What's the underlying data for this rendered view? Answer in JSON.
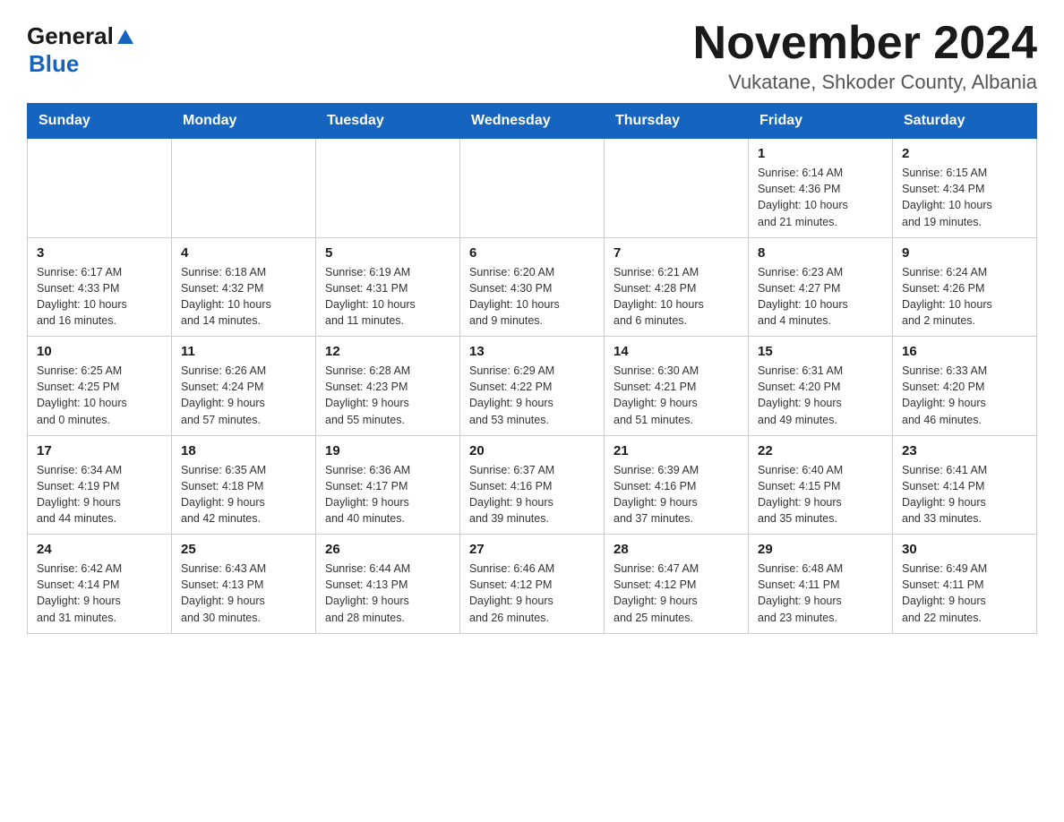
{
  "header": {
    "logo": {
      "general": "General",
      "blue": "Blue"
    },
    "title": "November 2024",
    "location": "Vukatane, Shkoder County, Albania"
  },
  "calendar": {
    "days": [
      "Sunday",
      "Monday",
      "Tuesday",
      "Wednesday",
      "Thursday",
      "Friday",
      "Saturday"
    ],
    "weeks": [
      [
        {
          "day": "",
          "info": ""
        },
        {
          "day": "",
          "info": ""
        },
        {
          "day": "",
          "info": ""
        },
        {
          "day": "",
          "info": ""
        },
        {
          "day": "",
          "info": ""
        },
        {
          "day": "1",
          "info": "Sunrise: 6:14 AM\nSunset: 4:36 PM\nDaylight: 10 hours\nand 21 minutes."
        },
        {
          "day": "2",
          "info": "Sunrise: 6:15 AM\nSunset: 4:34 PM\nDaylight: 10 hours\nand 19 minutes."
        }
      ],
      [
        {
          "day": "3",
          "info": "Sunrise: 6:17 AM\nSunset: 4:33 PM\nDaylight: 10 hours\nand 16 minutes."
        },
        {
          "day": "4",
          "info": "Sunrise: 6:18 AM\nSunset: 4:32 PM\nDaylight: 10 hours\nand 14 minutes."
        },
        {
          "day": "5",
          "info": "Sunrise: 6:19 AM\nSunset: 4:31 PM\nDaylight: 10 hours\nand 11 minutes."
        },
        {
          "day": "6",
          "info": "Sunrise: 6:20 AM\nSunset: 4:30 PM\nDaylight: 10 hours\nand 9 minutes."
        },
        {
          "day": "7",
          "info": "Sunrise: 6:21 AM\nSunset: 4:28 PM\nDaylight: 10 hours\nand 6 minutes."
        },
        {
          "day": "8",
          "info": "Sunrise: 6:23 AM\nSunset: 4:27 PM\nDaylight: 10 hours\nand 4 minutes."
        },
        {
          "day": "9",
          "info": "Sunrise: 6:24 AM\nSunset: 4:26 PM\nDaylight: 10 hours\nand 2 minutes."
        }
      ],
      [
        {
          "day": "10",
          "info": "Sunrise: 6:25 AM\nSunset: 4:25 PM\nDaylight: 10 hours\nand 0 minutes."
        },
        {
          "day": "11",
          "info": "Sunrise: 6:26 AM\nSunset: 4:24 PM\nDaylight: 9 hours\nand 57 minutes."
        },
        {
          "day": "12",
          "info": "Sunrise: 6:28 AM\nSunset: 4:23 PM\nDaylight: 9 hours\nand 55 minutes."
        },
        {
          "day": "13",
          "info": "Sunrise: 6:29 AM\nSunset: 4:22 PM\nDaylight: 9 hours\nand 53 minutes."
        },
        {
          "day": "14",
          "info": "Sunrise: 6:30 AM\nSunset: 4:21 PM\nDaylight: 9 hours\nand 51 minutes."
        },
        {
          "day": "15",
          "info": "Sunrise: 6:31 AM\nSunset: 4:20 PM\nDaylight: 9 hours\nand 49 minutes."
        },
        {
          "day": "16",
          "info": "Sunrise: 6:33 AM\nSunset: 4:20 PM\nDaylight: 9 hours\nand 46 minutes."
        }
      ],
      [
        {
          "day": "17",
          "info": "Sunrise: 6:34 AM\nSunset: 4:19 PM\nDaylight: 9 hours\nand 44 minutes."
        },
        {
          "day": "18",
          "info": "Sunrise: 6:35 AM\nSunset: 4:18 PM\nDaylight: 9 hours\nand 42 minutes."
        },
        {
          "day": "19",
          "info": "Sunrise: 6:36 AM\nSunset: 4:17 PM\nDaylight: 9 hours\nand 40 minutes."
        },
        {
          "day": "20",
          "info": "Sunrise: 6:37 AM\nSunset: 4:16 PM\nDaylight: 9 hours\nand 39 minutes."
        },
        {
          "day": "21",
          "info": "Sunrise: 6:39 AM\nSunset: 4:16 PM\nDaylight: 9 hours\nand 37 minutes."
        },
        {
          "day": "22",
          "info": "Sunrise: 6:40 AM\nSunset: 4:15 PM\nDaylight: 9 hours\nand 35 minutes."
        },
        {
          "day": "23",
          "info": "Sunrise: 6:41 AM\nSunset: 4:14 PM\nDaylight: 9 hours\nand 33 minutes."
        }
      ],
      [
        {
          "day": "24",
          "info": "Sunrise: 6:42 AM\nSunset: 4:14 PM\nDaylight: 9 hours\nand 31 minutes."
        },
        {
          "day": "25",
          "info": "Sunrise: 6:43 AM\nSunset: 4:13 PM\nDaylight: 9 hours\nand 30 minutes."
        },
        {
          "day": "26",
          "info": "Sunrise: 6:44 AM\nSunset: 4:13 PM\nDaylight: 9 hours\nand 28 minutes."
        },
        {
          "day": "27",
          "info": "Sunrise: 6:46 AM\nSunset: 4:12 PM\nDaylight: 9 hours\nand 26 minutes."
        },
        {
          "day": "28",
          "info": "Sunrise: 6:47 AM\nSunset: 4:12 PM\nDaylight: 9 hours\nand 25 minutes."
        },
        {
          "day": "29",
          "info": "Sunrise: 6:48 AM\nSunset: 4:11 PM\nDaylight: 9 hours\nand 23 minutes."
        },
        {
          "day": "30",
          "info": "Sunrise: 6:49 AM\nSunset: 4:11 PM\nDaylight: 9 hours\nand 22 minutes."
        }
      ]
    ]
  }
}
